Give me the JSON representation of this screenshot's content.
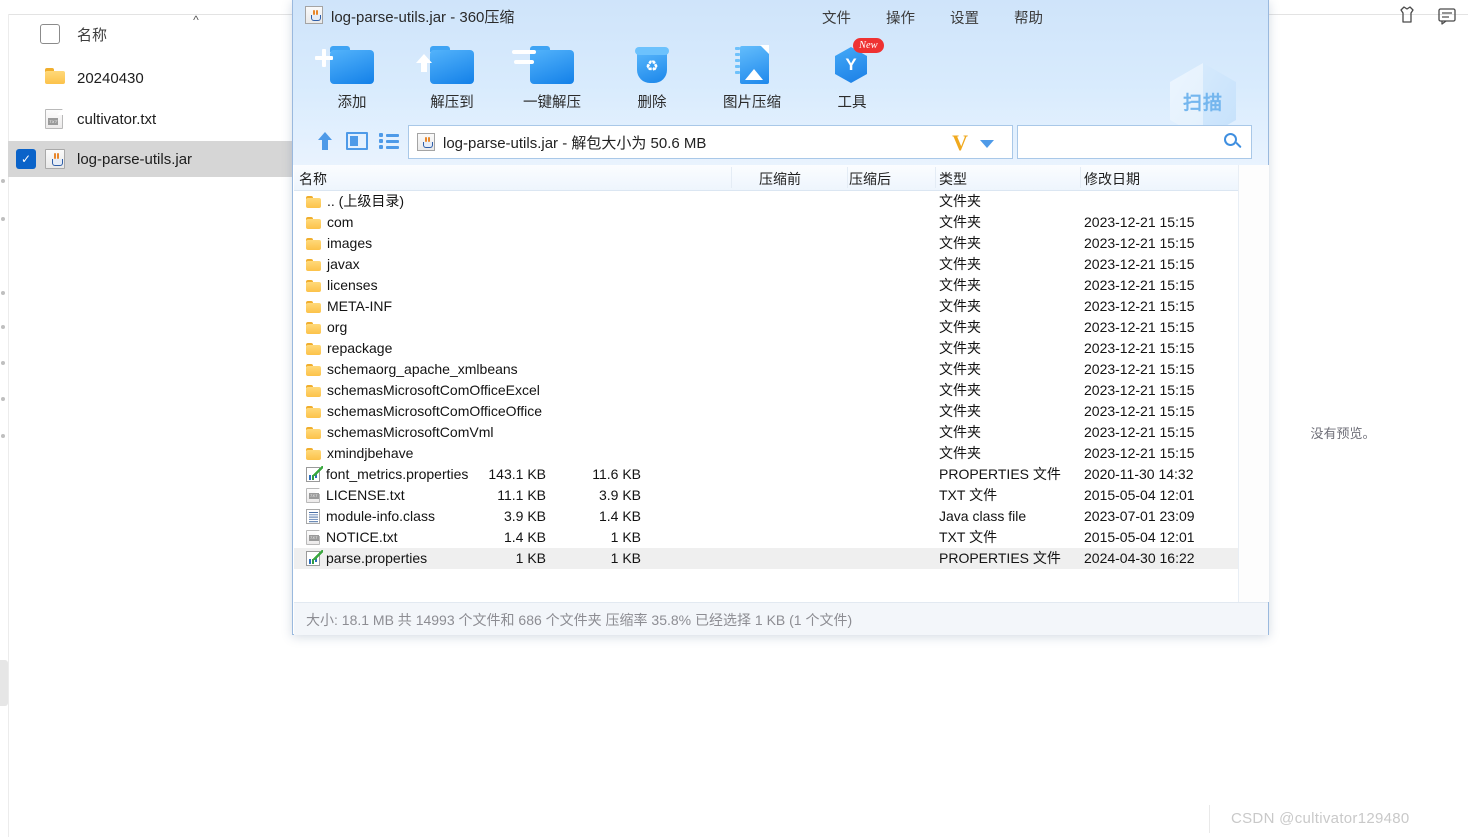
{
  "background": {
    "column_header": "名称",
    "items": [
      {
        "label": "20240430",
        "icon": "folder-icon",
        "checked": false,
        "selected": false
      },
      {
        "label": "cultivator.txt",
        "icon": "txt-file-icon",
        "checked": false,
        "selected": false
      },
      {
        "label": "log-parse-utils.jar",
        "icon": "jar-file-icon",
        "checked": true,
        "selected": true
      }
    ],
    "preview_text": "没有预览。",
    "watermark": "CSDN @cultivator129480"
  },
  "zip_window": {
    "title": "log-parse-utils.jar - 360压缩",
    "title_icon": "jar-file-icon",
    "menu": [
      {
        "label": "文件",
        "name": "menu-file"
      },
      {
        "label": "操作",
        "name": "menu-action"
      },
      {
        "label": "设置",
        "name": "menu-settings"
      },
      {
        "label": "帮助",
        "name": "menu-help"
      }
    ],
    "title_tools": [
      {
        "name": "skin-icon"
      },
      {
        "name": "feedback-icon"
      }
    ],
    "window_controls": [
      {
        "name": "minimize-button"
      },
      {
        "name": "maximize-button"
      },
      {
        "name": "close-button",
        "glyph": "✕"
      }
    ],
    "toolbar": [
      {
        "label": "添加",
        "name": "add-button",
        "icon": "folder-plus-icon"
      },
      {
        "label": "解压到",
        "name": "extract-to-button",
        "icon": "folder-arrow-up-icon"
      },
      {
        "label": "一键解压",
        "name": "one-click-extract-button",
        "icon": "folder-bars-icon"
      },
      {
        "label": "删除",
        "name": "delete-button",
        "icon": "recycle-bin-icon"
      },
      {
        "label": "图片压缩",
        "name": "image-compress-button",
        "icon": "image-zip-icon"
      },
      {
        "label": "工具",
        "name": "tools-button",
        "icon": "hexagon-y-icon",
        "badge": "New"
      }
    ],
    "scan_badge": {
      "label": "扫描",
      "name": "scan-badge"
    },
    "address_bar": {
      "up_icon": "arrow-up-icon",
      "panel_icon": "preview-panel-icon",
      "list_icon": "list-view-icon",
      "file_icon": "jar-file-icon",
      "path_text": "log-parse-utils.jar - 解包大小为 50.6 MB",
      "dropdown_logo": "V",
      "dropdown_icon": "chevron-down-icon"
    },
    "search": {
      "value": "",
      "placeholder": "",
      "icon": "search-icon"
    },
    "list": {
      "columns": [
        "名称",
        "压缩前",
        "压缩后",
        "类型",
        "修改日期"
      ],
      "rows": [
        {
          "name": ".. (上级目录)",
          "icon": "folder-icon",
          "pre": "",
          "post": "",
          "type": "文件夹",
          "date": "",
          "selected": false
        },
        {
          "name": "com",
          "icon": "folder-icon",
          "pre": "",
          "post": "",
          "type": "文件夹",
          "date": "2023-12-21 15:15",
          "selected": false
        },
        {
          "name": "images",
          "icon": "folder-icon",
          "pre": "",
          "post": "",
          "type": "文件夹",
          "date": "2023-12-21 15:15",
          "selected": false
        },
        {
          "name": "javax",
          "icon": "folder-icon",
          "pre": "",
          "post": "",
          "type": "文件夹",
          "date": "2023-12-21 15:15",
          "selected": false
        },
        {
          "name": "licenses",
          "icon": "folder-icon",
          "pre": "",
          "post": "",
          "type": "文件夹",
          "date": "2023-12-21 15:15",
          "selected": false
        },
        {
          "name": "META-INF",
          "icon": "folder-icon",
          "pre": "",
          "post": "",
          "type": "文件夹",
          "date": "2023-12-21 15:15",
          "selected": false
        },
        {
          "name": "org",
          "icon": "folder-icon",
          "pre": "",
          "post": "",
          "type": "文件夹",
          "date": "2023-12-21 15:15",
          "selected": false
        },
        {
          "name": "repackage",
          "icon": "folder-icon",
          "pre": "",
          "post": "",
          "type": "文件夹",
          "date": "2023-12-21 15:15",
          "selected": false
        },
        {
          "name": "schemaorg_apache_xmlbeans",
          "icon": "folder-icon",
          "pre": "",
          "post": "",
          "type": "文件夹",
          "date": "2023-12-21 15:15",
          "selected": false
        },
        {
          "name": "schemasMicrosoftComOfficeExcel",
          "icon": "folder-icon",
          "pre": "",
          "post": "",
          "type": "文件夹",
          "date": "2023-12-21 15:15",
          "selected": false
        },
        {
          "name": "schemasMicrosoftComOfficeOffice",
          "icon": "folder-icon",
          "pre": "",
          "post": "",
          "type": "文件夹",
          "date": "2023-12-21 15:15",
          "selected": false
        },
        {
          "name": "schemasMicrosoftComVml",
          "icon": "folder-icon",
          "pre": "",
          "post": "",
          "type": "文件夹",
          "date": "2023-12-21 15:15",
          "selected": false
        },
        {
          "name": "xmindjbehave",
          "icon": "folder-icon",
          "pre": "",
          "post": "",
          "type": "文件夹",
          "date": "2023-12-21 15:15",
          "selected": false
        },
        {
          "name": "font_metrics.properties",
          "icon": "properties-file-icon",
          "pre": "143.1 KB",
          "post": "11.6 KB",
          "type": "PROPERTIES 文件",
          "date": "2020-11-30 14:32",
          "selected": false
        },
        {
          "name": "LICENSE.txt",
          "icon": "txt-file-icon",
          "pre": "11.1 KB",
          "post": "3.9 KB",
          "type": "TXT 文件",
          "date": "2015-05-04 12:01",
          "selected": false
        },
        {
          "name": "module-info.class",
          "icon": "class-file-icon",
          "pre": "3.9 KB",
          "post": "1.4 KB",
          "type": "Java class file",
          "date": "2023-07-01 23:09",
          "selected": false
        },
        {
          "name": "NOTICE.txt",
          "icon": "txt-file-icon",
          "pre": "1.4 KB",
          "post": "1 KB",
          "type": "TXT 文件",
          "date": "2015-05-04 12:01",
          "selected": false
        },
        {
          "name": "parse.properties",
          "icon": "properties-file-icon",
          "pre": "1 KB",
          "post": "1 KB",
          "type": "PROPERTIES 文件",
          "date": "2024-04-30 16:22",
          "selected": true
        }
      ]
    },
    "status": "大小: 18.1 MB 共 14993 个文件和 686 个文件夹 压缩率 35.8% 已经选择 1 KB (1 个文件)"
  },
  "colors": {
    "accent_blue": "#1b86ea",
    "chrome_blue": "#d8ebfd",
    "selection_gray": "#efefef",
    "folder_yellow": "#fcc24a",
    "badge_red": "#ef3232"
  }
}
